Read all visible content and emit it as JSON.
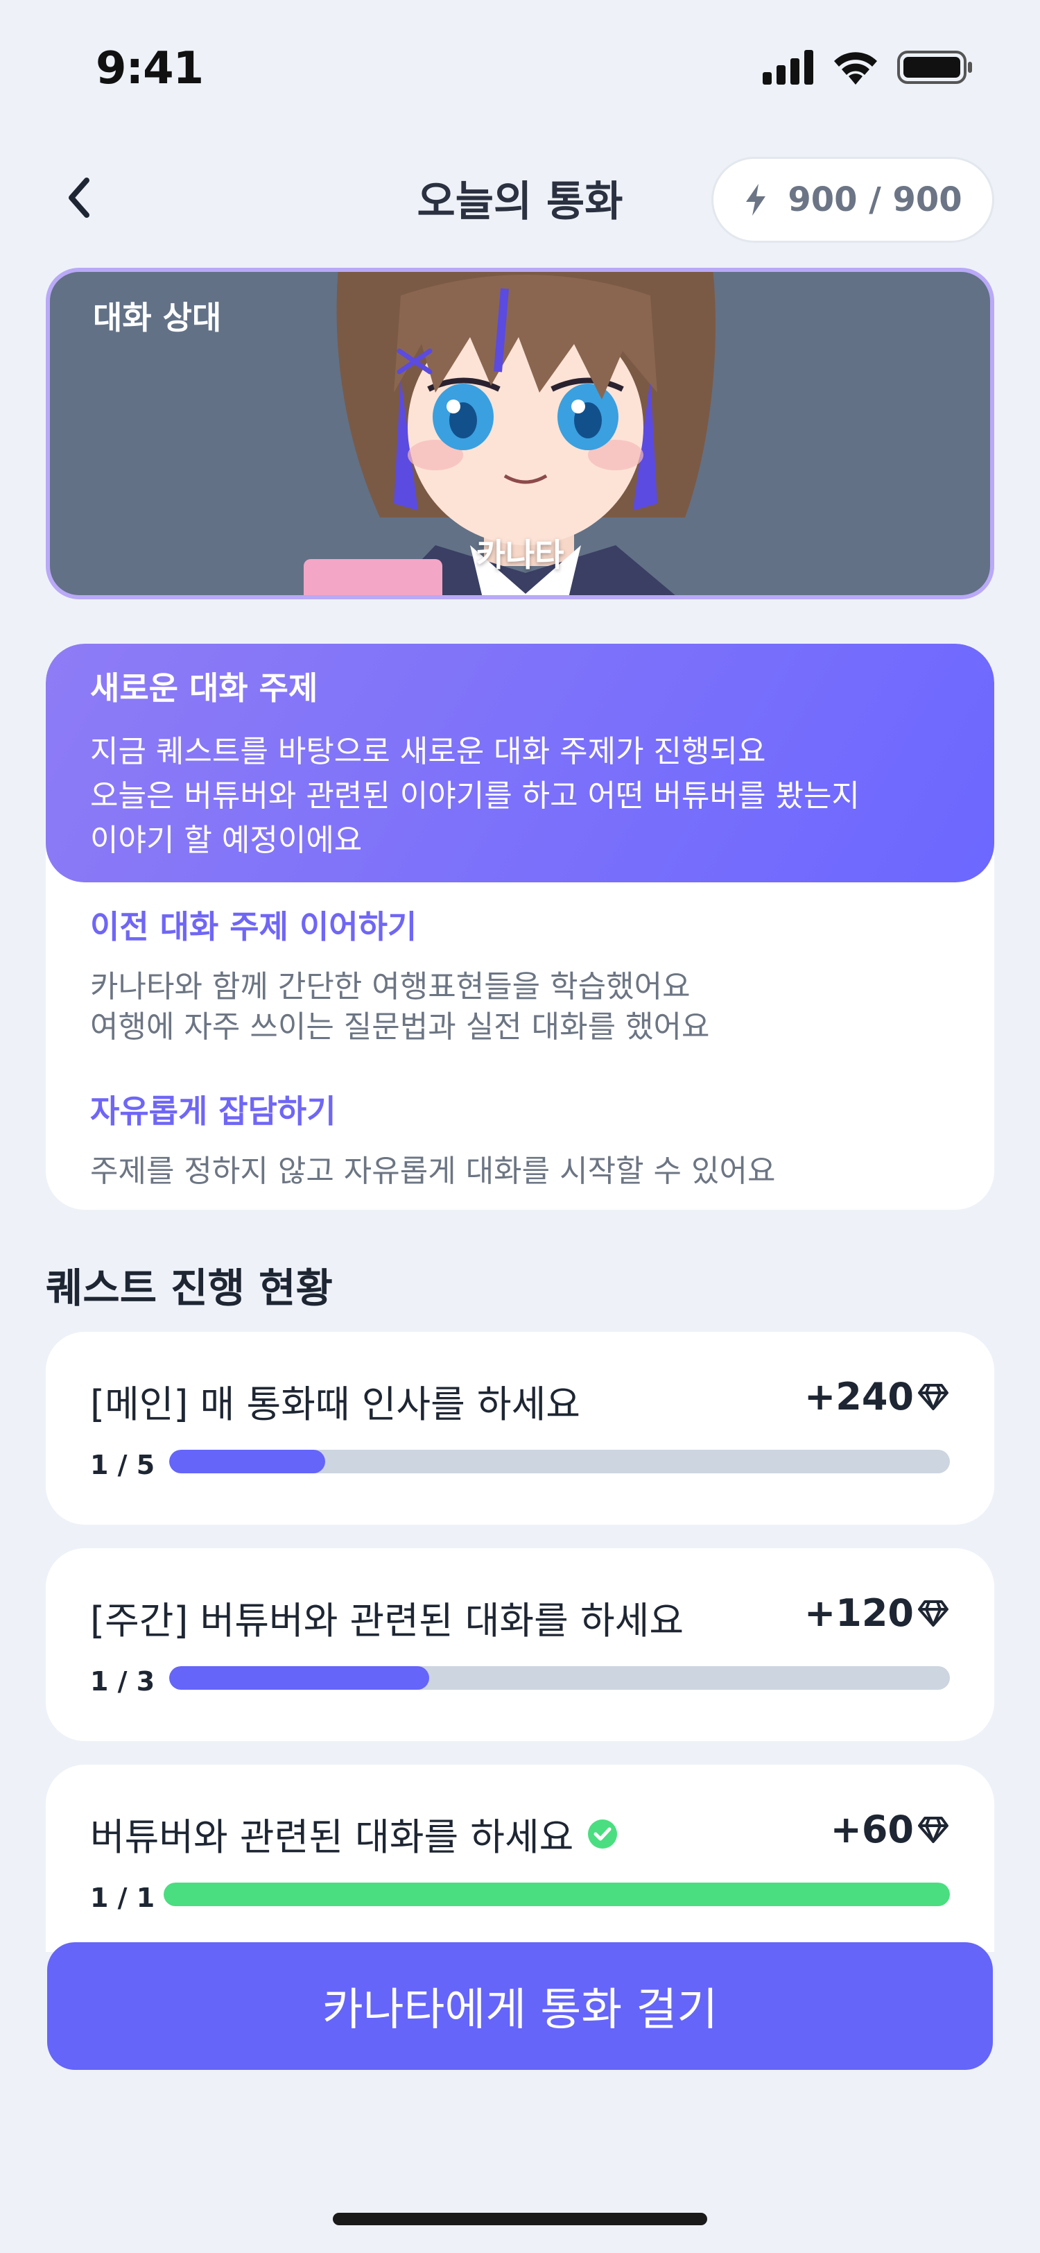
{
  "status_bar": {
    "time": "9:41"
  },
  "header": {
    "title": "오늘의 통화",
    "energy": "900 / 900"
  },
  "partner": {
    "label": "대화 상대",
    "name": "카나타"
  },
  "topics": {
    "active": {
      "title": "새로운 대화 주제",
      "lines": [
        "지금 퀘스트를 바탕으로 새로운 대화 주제가 진행되요",
        "오늘은 버튜버와 관련된 이야기를 하고 어떤 버튜버를 봤는지",
        "이야기 할 예정이에요"
      ]
    },
    "continue": {
      "title": "이전 대화 주제 이어하기",
      "lines": [
        "카나타와 함께 간단한 여행표현들을 학습했어요",
        "여행에 자주 쓰이는 질문법과 실전 대화를 했어요"
      ]
    },
    "free": {
      "title": "자유롭게 잡담하기",
      "lines": [
        "주제를 정하지 않고 자유롭게 대화를 시작할 수 있어요"
      ]
    }
  },
  "quests": {
    "section_title": "퀘스트 진행 현황",
    "items": [
      {
        "title": "[메인] 매 통화때 인사를 하세요",
        "reward": "+240",
        "count": "1 / 5",
        "progress": 0.2,
        "completed": false,
        "bar_color": "#6565F9"
      },
      {
        "title": "[주간] 버튜버와 관련된 대화를 하세요",
        "reward": "+120",
        "count": "1 / 3",
        "progress": 0.333,
        "completed": false,
        "bar_color": "#6565F9"
      },
      {
        "title": "버튜버와 관련된 대화를 하세요",
        "reward": "+60",
        "count": "1 / 1",
        "progress": 1.0,
        "completed": true,
        "bar_color": "#4ADE80"
      }
    ]
  },
  "call_button": {
    "label": "카나타에게 통화 걸기"
  },
  "colors": {
    "accent": "#6565F9",
    "topic_highlight": "#6F66F6",
    "success": "#4ADE80",
    "partner_bg": "#627186"
  },
  "icons": {
    "back": "chevron-left-icon",
    "energy": "lightning-icon",
    "reward": "diamond-icon",
    "done": "check-circle-icon"
  }
}
